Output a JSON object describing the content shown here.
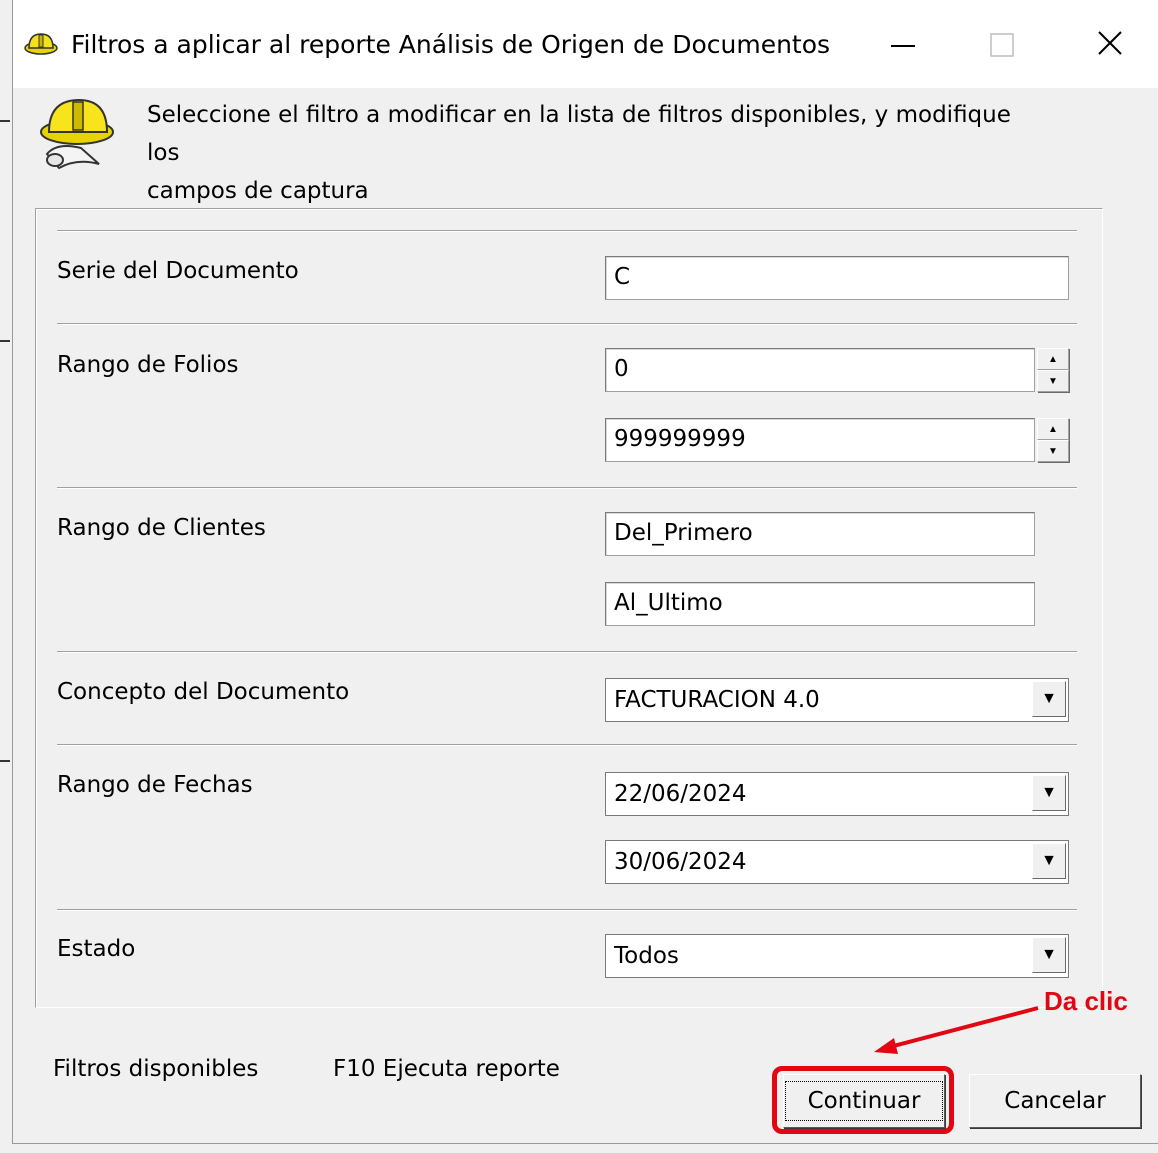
{
  "window": {
    "title": "Filtros a aplicar al reporte Análisis de Origen de Documentos",
    "minimize_glyph": "—",
    "maximize_glyph": "☐",
    "close_glyph": "✕"
  },
  "header": {
    "instruction_line1": "Seleccione el filtro a modificar  en la lista de filtros disponibles, y modifique los",
    "instruction_line2": "campos de  captura",
    "icon": "hardhat-blueprint-icon"
  },
  "filters": {
    "serie": {
      "label": "Serie del Documento",
      "value": "C"
    },
    "folios": {
      "label": "Rango de Folios",
      "from": "0",
      "to": "999999999"
    },
    "clientes": {
      "label": "Rango de Clientes",
      "from": "Del_Primero",
      "to": "Al_Ultimo"
    },
    "concepto": {
      "label": "Concepto del Documento",
      "value": "FACTURACION 4.0"
    },
    "fechas": {
      "label": "Rango de Fechas",
      "from": "22/06/2024",
      "to": "30/06/2024"
    },
    "estado": {
      "label": "Estado",
      "value": "Todos"
    }
  },
  "footer": {
    "available_filters": "Filtros disponibles",
    "f10_hint": "F10 Ejecuta reporte",
    "continue_label": "Continuar",
    "cancel_label": "Cancelar"
  },
  "annotation": {
    "text": "Da clic",
    "color": "#e30613"
  }
}
